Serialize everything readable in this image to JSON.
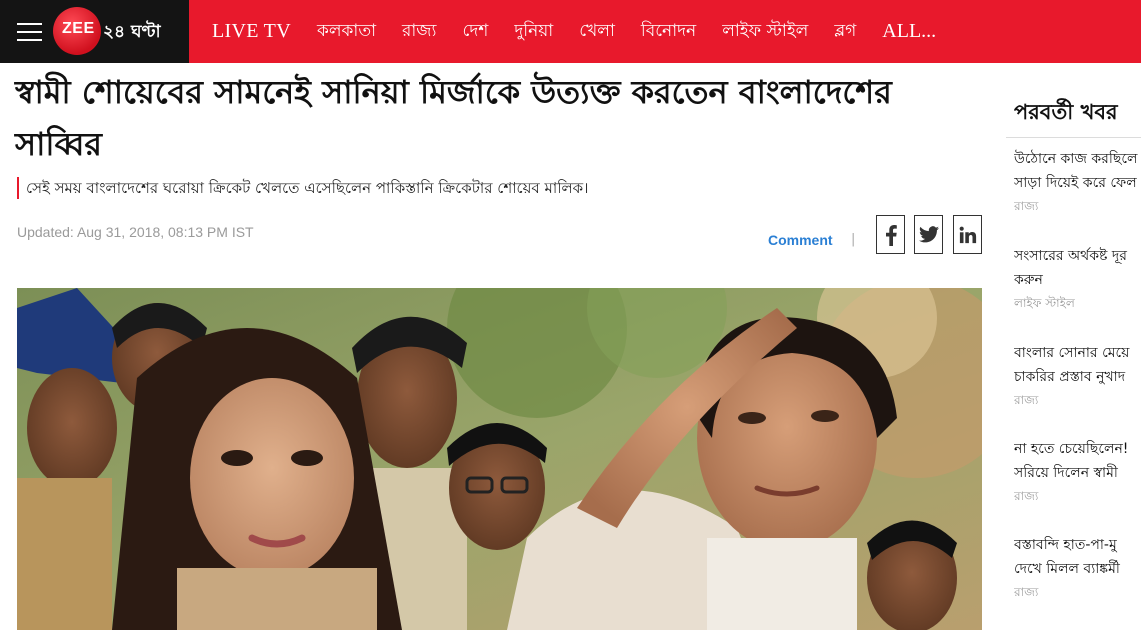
{
  "header": {
    "logo_brand": "ZEE",
    "logo_tag": "২৪ ঘণ্টা",
    "nav": [
      {
        "label": "LIVE TV"
      },
      {
        "label": "কলকাতা"
      },
      {
        "label": "রাজ্য"
      },
      {
        "label": "দেশ"
      },
      {
        "label": "দুনিয়া"
      },
      {
        "label": "খেলা"
      },
      {
        "label": "বিনোদন"
      },
      {
        "label": "লাইফ স্টাইল"
      },
      {
        "label": "ব্লগ"
      },
      {
        "label": "ALL..."
      }
    ],
    "colors": {
      "bar": "#e8192c",
      "brand_box": "#141414"
    }
  },
  "article": {
    "headline": "স্বামী শোয়েবের সামনেই সানিয়া মির্জাকে উত্যক্ত করতেন বাংলাদেশের সাব্বির",
    "summary": "সেই সময় বাংলাদেশের ঘরোয়া ক্রিকেট খেলতে এসেছিলেন পাকিস্তানি ক্রিকেটার শোয়েব মালিক।",
    "updated": "Updated: Aug 31, 2018, 08:13 PM IST",
    "comment_label": "Comment",
    "separator": "|",
    "share_icons": [
      "facebook-icon",
      "twitter-icon",
      "linkedin-icon"
    ],
    "accent": "#2a7fd4"
  },
  "sidebar": {
    "title": "পরবর্তী খবর",
    "items": [
      {
        "line1": "উঠোনে কাজ করছিলে",
        "line2": "সাড়া দিয়েই করে ফেল",
        "category": "রাজ্য"
      },
      {
        "line1": "সংসারের অর্থকষ্ট দূর",
        "line2": "করুন",
        "category": "লাইফ স্টাইল"
      },
      {
        "line1": "বাংলার সোনার মেয়ে",
        "line2": "চাকরির প্রস্তাব নুখাদ",
        "category": "রাজ্য"
      },
      {
        "line1": "না হতে চেয়েছিলেন!",
        "line2": "সরিয়ে দিলেন স্বামী",
        "category": "রাজ্য"
      },
      {
        "line1": "বস্তাবন্দি হাত-পা-মু",
        "line2": "দেখে মিলল ব্যাঙ্কর্মী",
        "category": "রাজ্য"
      }
    ]
  }
}
